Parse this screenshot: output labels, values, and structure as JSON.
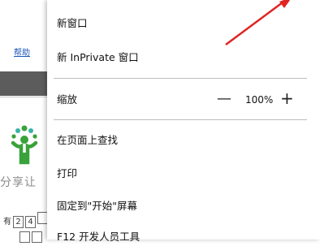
{
  "background": {
    "help_link": "帮助",
    "share_text": "分享让",
    "row_label": "有",
    "row_cells": [
      "2",
      "4",
      ""
    ]
  },
  "menu": {
    "new_window": "新窗口",
    "new_inprivate": "新 InPrivate 窗口",
    "zoom_label": "缩放",
    "zoom_out_symbol": "—",
    "zoom_value": "100%",
    "zoom_in_symbol": "+",
    "find_on_page": "在页面上查找",
    "print": "打印",
    "pin_to_start": "固定到\"开始\"屏幕",
    "dev_tools": "F12 开发人员工具"
  },
  "colors": {
    "arrow": "#e02424",
    "link": "#1a56b8",
    "logo_green": "#3aa23a",
    "logo_teal": "#3bb3a4"
  }
}
